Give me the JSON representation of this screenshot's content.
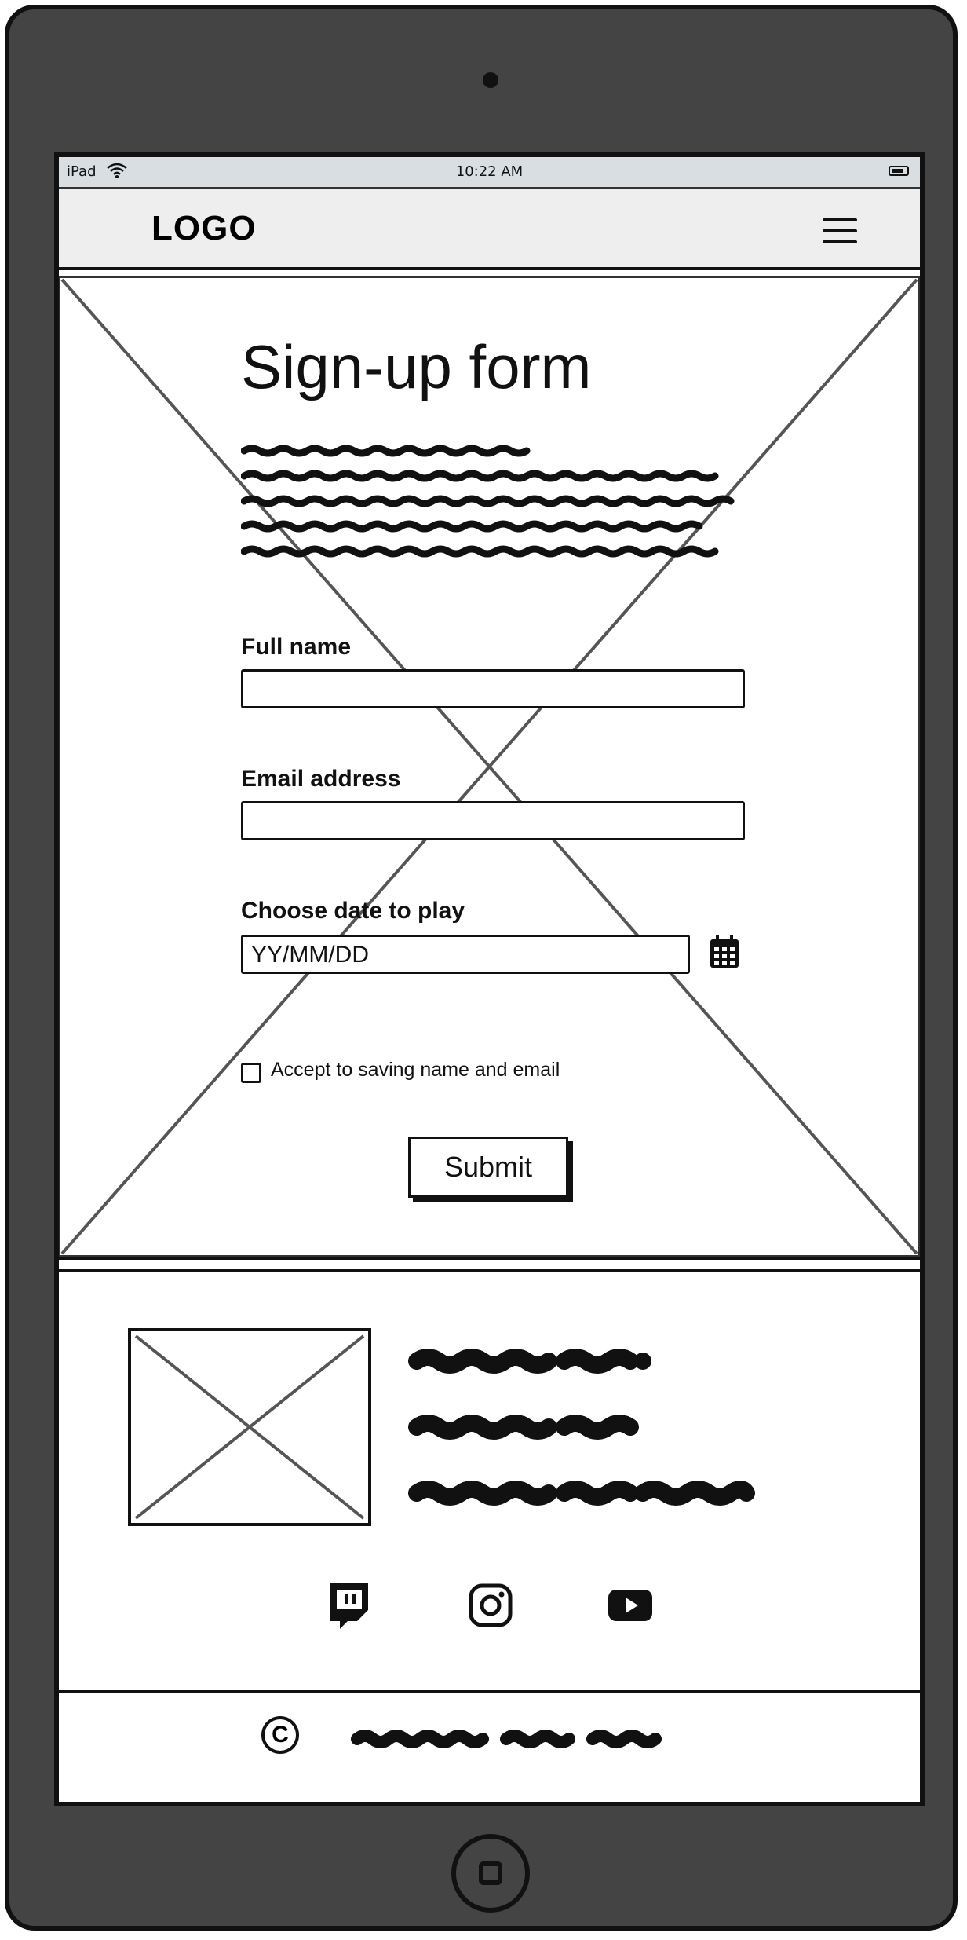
{
  "status_bar": {
    "device": "iPad",
    "time": "10:22 AM"
  },
  "header": {
    "logo": "LOGO",
    "menu_icon": "hamburger-menu-icon"
  },
  "form": {
    "title": "Sign-up form",
    "full_name_label": "Full name",
    "full_name_value": "",
    "email_label": "Email address",
    "email_value": "",
    "date_label": "Choose date to play",
    "date_value": "YY/MM/DD",
    "date_icon": "calendar-icon",
    "checkbox_label": "Accept to saving name and email",
    "submit_label": "Submit"
  },
  "footer": {
    "social": [
      "twitch-icon",
      "instagram-icon",
      "youtube-icon"
    ]
  }
}
